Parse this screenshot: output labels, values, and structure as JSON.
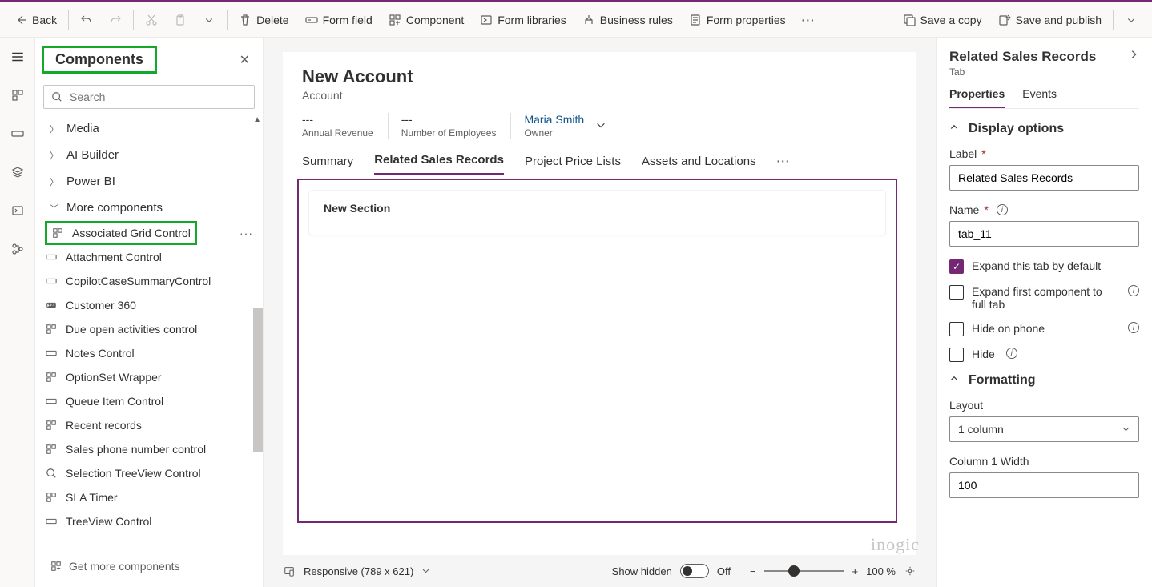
{
  "cmdbar": {
    "back": "Back",
    "delete": "Delete",
    "form_field": "Form field",
    "component": "Component",
    "form_libraries": "Form libraries",
    "business_rules": "Business rules",
    "form_properties": "Form properties",
    "save_copy": "Save a copy",
    "save_publish": "Save and publish"
  },
  "sidebar": {
    "title": "Components",
    "search_placeholder": "Search",
    "groups": [
      {
        "label": "Media"
      },
      {
        "label": "AI Builder"
      },
      {
        "label": "Power BI"
      },
      {
        "label": "More components"
      }
    ],
    "items": [
      {
        "label": "Associated Grid Control"
      },
      {
        "label": "Attachment Control"
      },
      {
        "label": "CopilotCaseSummaryControl"
      },
      {
        "label": "Customer 360"
      },
      {
        "label": "Due open activities control"
      },
      {
        "label": "Notes Control"
      },
      {
        "label": "OptionSet Wrapper"
      },
      {
        "label": "Queue Item Control"
      },
      {
        "label": "Recent records"
      },
      {
        "label": "Sales phone number control"
      },
      {
        "label": "Selection TreeView Control"
      },
      {
        "label": "SLA Timer"
      },
      {
        "label": "TreeView Control"
      }
    ],
    "get_more": "Get more components"
  },
  "form": {
    "title": "New Account",
    "entity": "Account",
    "fields": [
      {
        "value": "---",
        "label": "Annual Revenue"
      },
      {
        "value": "---",
        "label": "Number of Employees"
      },
      {
        "value": "Maria Smith",
        "label": "Owner",
        "link": true
      }
    ],
    "tabs": [
      {
        "label": "Summary"
      },
      {
        "label": "Related Sales Records",
        "active": true
      },
      {
        "label": "Project Price Lists"
      },
      {
        "label": "Assets and Locations"
      }
    ],
    "section_name": "New Section"
  },
  "footer": {
    "responsive": "Responsive (789 x 621)",
    "show_hidden": "Show hidden",
    "toggle_state": "Off",
    "zoom": "100 %"
  },
  "props": {
    "title": "Related Sales Records",
    "sub": "Tab",
    "tabs": {
      "properties": "Properties",
      "events": "Events"
    },
    "display_options": "Display options",
    "label_field": "Label",
    "label_value": "Related Sales Records",
    "name_field": "Name",
    "name_value": "tab_11",
    "expand_default": "Expand this tab by default",
    "expand_first": "Expand first component to full tab",
    "hide_phone": "Hide on phone",
    "hide": "Hide",
    "formatting": "Formatting",
    "layout": "Layout",
    "layout_value": "1 column",
    "col1_width": "Column 1 Width",
    "col1_value": "100"
  },
  "watermark": "inogic"
}
